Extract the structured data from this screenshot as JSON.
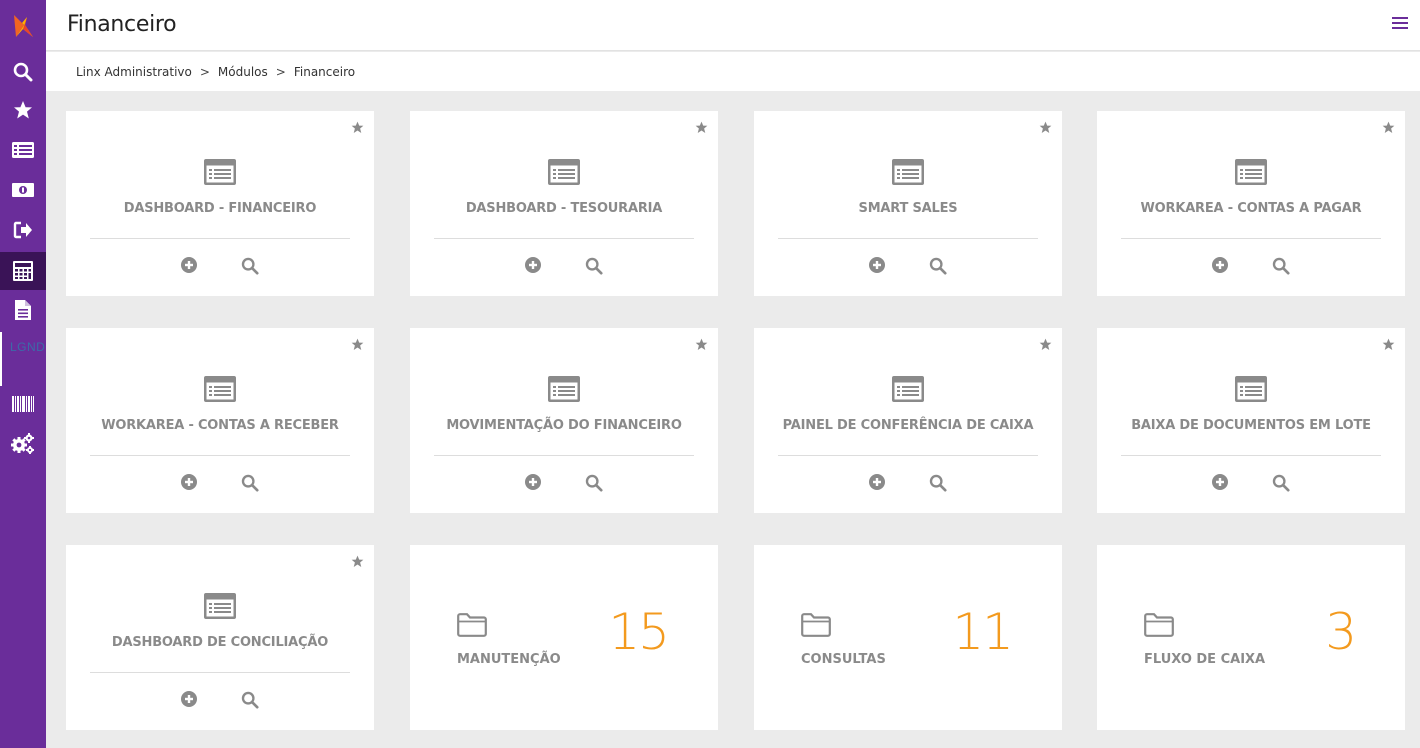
{
  "app": {
    "title": "Financeiro"
  },
  "breadcrumb": [
    "Linx Administrativo",
    ">",
    "Módulos",
    ">",
    "Financeiro"
  ],
  "sidebar": {
    "items": [
      {
        "icon": "logo-icon"
      },
      {
        "icon": "search-icon"
      },
      {
        "icon": "star-icon"
      },
      {
        "icon": "list-icon"
      },
      {
        "icon": "money-icon"
      },
      {
        "icon": "sign-out-icon"
      },
      {
        "icon": "calculator-icon",
        "active": true
      },
      {
        "icon": "document-icon"
      },
      {
        "icon": "barcode-icon"
      },
      {
        "icon": "settings-icon"
      }
    ],
    "marker_text": "LGND"
  },
  "modules": [
    {
      "title": "DASHBOARD - FINANCEIRO"
    },
    {
      "title": "DASHBOARD - TESOURARIA"
    },
    {
      "title": "SMART SALES"
    },
    {
      "title": "WORKAREA - CONTAS A PAGAR"
    },
    {
      "title": "WORKAREA - CONTAS A RECEBER"
    },
    {
      "title": "MOVIMENTAÇÃO DO FINANCEIRO"
    },
    {
      "title": "PAINEL DE CONFERÊNCIA DE CAIXA"
    },
    {
      "title": "BAIXA DE DOCUMENTOS EM LOTE"
    },
    {
      "title": "DASHBOARD DE CONCILIAÇÃO"
    }
  ],
  "folders": [
    {
      "title": "MANUTENÇÃO",
      "count": "15"
    },
    {
      "title": "CONSULTAS",
      "count": "11"
    },
    {
      "title": "FLUXO DE CAIXA",
      "count": "3"
    }
  ],
  "colors": {
    "sidebar": "#6a2d9a",
    "sidebar_active": "#3a1357",
    "accent_count": "#f39a1e",
    "icon_gray": "#8a8a8a"
  }
}
